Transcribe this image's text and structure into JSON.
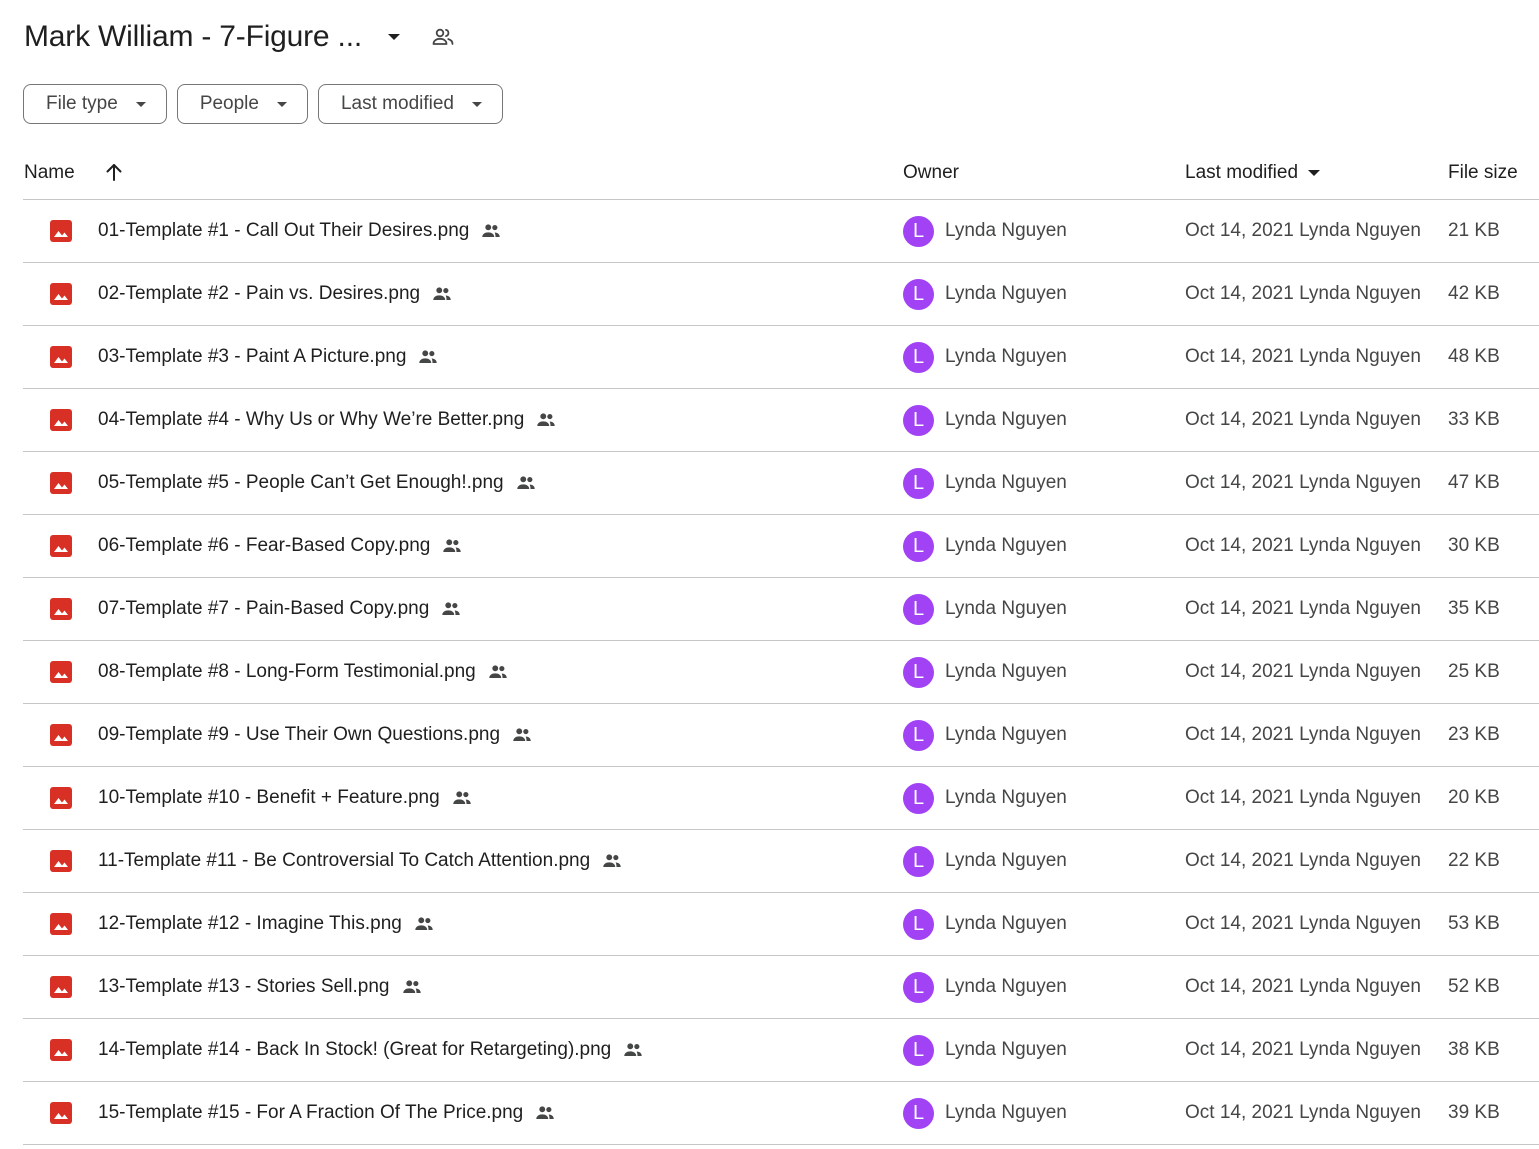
{
  "header": {
    "folder_title": "Mark William - 7-Figure ..."
  },
  "filters": {
    "file_type": "File type",
    "people": "People",
    "last_modified": "Last modified"
  },
  "columns": {
    "name": "Name",
    "owner": "Owner",
    "last_modified": "Last modified",
    "file_size": "File size"
  },
  "icons": {
    "file": "image-file-icon",
    "shared": "shared-people-icon",
    "sort": "arrow-up-icon"
  },
  "colors": {
    "file_icon": "#d93025",
    "avatar": "#a142f4"
  },
  "files": [
    {
      "name": "01-Template #1 - Call Out Their Desires.png",
      "owner_initial": "L",
      "owner": "Lynda Nguyen",
      "modified": "Oct 14, 2021 Lynda Nguyen",
      "size": "21 KB"
    },
    {
      "name": "02-Template #2 - Pain vs. Desires.png",
      "owner_initial": "L",
      "owner": "Lynda Nguyen",
      "modified": "Oct 14, 2021 Lynda Nguyen",
      "size": "42 KB"
    },
    {
      "name": "03-Template #3 - Paint A Picture.png",
      "owner_initial": "L",
      "owner": "Lynda Nguyen",
      "modified": "Oct 14, 2021 Lynda Nguyen",
      "size": "48 KB"
    },
    {
      "name": "04-Template #4 - Why Us or Why We’re Better.png",
      "owner_initial": "L",
      "owner": "Lynda Nguyen",
      "modified": "Oct 14, 2021 Lynda Nguyen",
      "size": "33 KB"
    },
    {
      "name": "05-Template #5 - People Can’t Get Enough!.png",
      "owner_initial": "L",
      "owner": "Lynda Nguyen",
      "modified": "Oct 14, 2021 Lynda Nguyen",
      "size": "47 KB"
    },
    {
      "name": "06-Template #6 - Fear-Based Copy.png",
      "owner_initial": "L",
      "owner": "Lynda Nguyen",
      "modified": "Oct 14, 2021 Lynda Nguyen",
      "size": "30 KB"
    },
    {
      "name": "07-Template #7 - Pain-Based Copy.png",
      "owner_initial": "L",
      "owner": "Lynda Nguyen",
      "modified": "Oct 14, 2021 Lynda Nguyen",
      "size": "35 KB"
    },
    {
      "name": "08-Template #8 - Long-Form Testimonial.png",
      "owner_initial": "L",
      "owner": "Lynda Nguyen",
      "modified": "Oct 14, 2021 Lynda Nguyen",
      "size": "25 KB"
    },
    {
      "name": "09-Template #9 - Use Their Own Questions.png",
      "owner_initial": "L",
      "owner": "Lynda Nguyen",
      "modified": "Oct 14, 2021 Lynda Nguyen",
      "size": "23 KB"
    },
    {
      "name": "10-Template #10 - Benefit + Feature.png",
      "owner_initial": "L",
      "owner": "Lynda Nguyen",
      "modified": "Oct 14, 2021 Lynda Nguyen",
      "size": "20 KB"
    },
    {
      "name": "11-Template #11 - Be Controversial To Catch Attention.png",
      "owner_initial": "L",
      "owner": "Lynda Nguyen",
      "modified": "Oct 14, 2021 Lynda Nguyen",
      "size": "22 KB"
    },
    {
      "name": "12-Template #12 - Imagine This.png",
      "owner_initial": "L",
      "owner": "Lynda Nguyen",
      "modified": "Oct 14, 2021 Lynda Nguyen",
      "size": "53 KB"
    },
    {
      "name": "13-Template #13 - Stories Sell.png",
      "owner_initial": "L",
      "owner": "Lynda Nguyen",
      "modified": "Oct 14, 2021 Lynda Nguyen",
      "size": "52 KB"
    },
    {
      "name": "14-Template #14 - Back In Stock! (Great for Retargeting).png",
      "owner_initial": "L",
      "owner": "Lynda Nguyen",
      "modified": "Oct 14, 2021 Lynda Nguyen",
      "size": "38 KB"
    },
    {
      "name": "15-Template #15 - For A Fraction Of The Price.png",
      "owner_initial": "L",
      "owner": "Lynda Nguyen",
      "modified": "Oct 14, 2021 Lynda Nguyen",
      "size": "39 KB"
    }
  ]
}
